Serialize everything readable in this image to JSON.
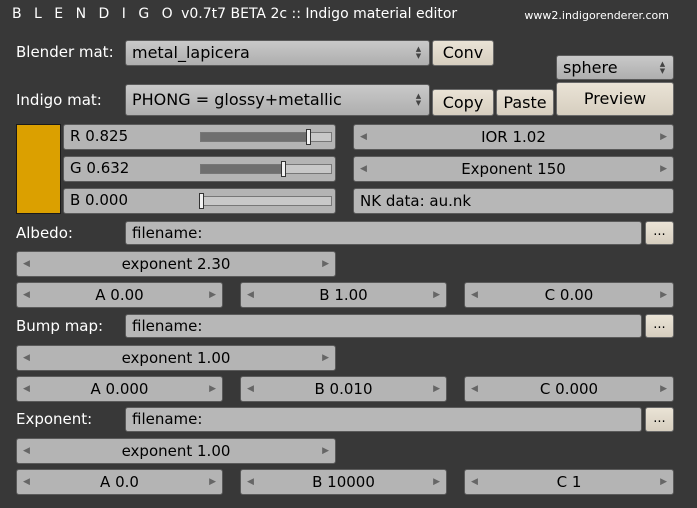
{
  "header": {
    "brand": "B L E N D I G O",
    "version": "v0.7t7 BETA 2c",
    "separator": "::",
    "subtitle": "Indigo material editor",
    "url": "www2.indigorenderer.com"
  },
  "blender_mat": {
    "label": "Blender mat:",
    "value": "metal_lapicera",
    "conv_label": "Conv"
  },
  "preview": {
    "shape": "sphere",
    "button_label": "Preview"
  },
  "indigo_mat": {
    "label": "Indigo mat:",
    "value": "PHONG = glossy+metallic",
    "copy_label": "Copy",
    "paste_label": "Paste"
  },
  "color": {
    "swatch": "#dba000",
    "r_label": "R 0.825",
    "r": 0.825,
    "g_label": "G 0.632",
    "g": 0.632,
    "b_label": "B 0.000",
    "b": 0.0
  },
  "ior": "IOR 1.02",
  "exponent_value": "Exponent 150",
  "nk_data": "NK data: au.nk",
  "albedo": {
    "label": "Albedo:",
    "filename": "filename:",
    "browse": "...",
    "exponent": "exponent 2.30",
    "a": "A 0.00",
    "b": "B 1.00",
    "c": "C 0.00"
  },
  "bump": {
    "label": "Bump map:",
    "filename": "filename:",
    "browse": "...",
    "exponent": "exponent 1.00",
    "a": "A 0.000",
    "b": "B 0.010",
    "c": "C 0.000"
  },
  "exponent_map": {
    "label": "Exponent:",
    "filename": "filename:",
    "browse": "...",
    "exponent": "exponent 1.00",
    "a": "A 0.0",
    "b": "B 10000",
    "c": "C 1"
  }
}
